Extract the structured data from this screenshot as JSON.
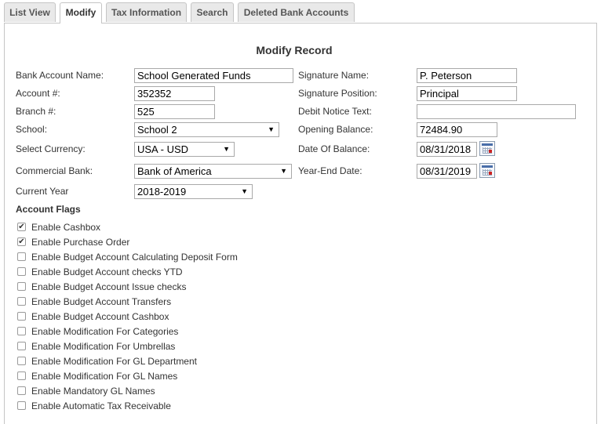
{
  "tabs": [
    "List View",
    "Modify",
    "Tax Information",
    "Search",
    "Deleted Bank Accounts"
  ],
  "form": {
    "title": "Modify Record",
    "bank_account_name": {
      "label": "Bank Account Name:",
      "value": "School Generated Funds"
    },
    "account_number": {
      "label": "Account #:",
      "value": "352352"
    },
    "branch_number": {
      "label": "Branch #:",
      "value": "525"
    },
    "school": {
      "label": "School:",
      "value": "School 2"
    },
    "currency": {
      "label": "Select Currency:",
      "value": "USA - USD"
    },
    "commercial_bank": {
      "label": "Commercial Bank:",
      "value": "Bank of America"
    },
    "current_year": {
      "label": "Current Year",
      "value": "2018-2019"
    },
    "signature_name": {
      "label": "Signature Name:",
      "value": "P. Peterson"
    },
    "signature_position": {
      "label": "Signature Position:",
      "value": "Principal"
    },
    "debit_notice_text": {
      "label": "Debit Notice Text:",
      "value": ""
    },
    "opening_balance": {
      "label": "Opening Balance:",
      "value": "72484.90"
    },
    "date_of_balance": {
      "label": "Date Of Balance:",
      "value": "08/31/2018"
    },
    "year_end_date": {
      "label": "Year-End Date:",
      "value": "08/31/2019"
    }
  },
  "account_flags": {
    "heading": "Account Flags",
    "items": [
      {
        "label": "Enable Cashbox",
        "checked": true
      },
      {
        "label": "Enable Purchase Order",
        "checked": true
      },
      {
        "label": "Enable Budget Account Calculating Deposit Form",
        "checked": false
      },
      {
        "label": "Enable Budget Account checks YTD",
        "checked": false
      },
      {
        "label": "Enable Budget Account Issue checks",
        "checked": false
      },
      {
        "label": "Enable Budget Account Transfers",
        "checked": false
      },
      {
        "label": "Enable Budget Account Cashbox",
        "checked": false
      },
      {
        "label": "Enable Modification For Categories",
        "checked": false
      },
      {
        "label": "Enable Modification For Umbrellas",
        "checked": false
      },
      {
        "label": "Enable Modification For GL Department",
        "checked": false
      },
      {
        "label": "Enable Modification For GL Names",
        "checked": false
      },
      {
        "label": "Enable Mandatory GL Names",
        "checked": false
      },
      {
        "label": "Enable Automatic Tax Receivable",
        "checked": false
      }
    ]
  },
  "icons": {
    "calendar": "calendar-icon",
    "dropdown": "chevron-down-icon",
    "check": "checkmark-icon"
  }
}
